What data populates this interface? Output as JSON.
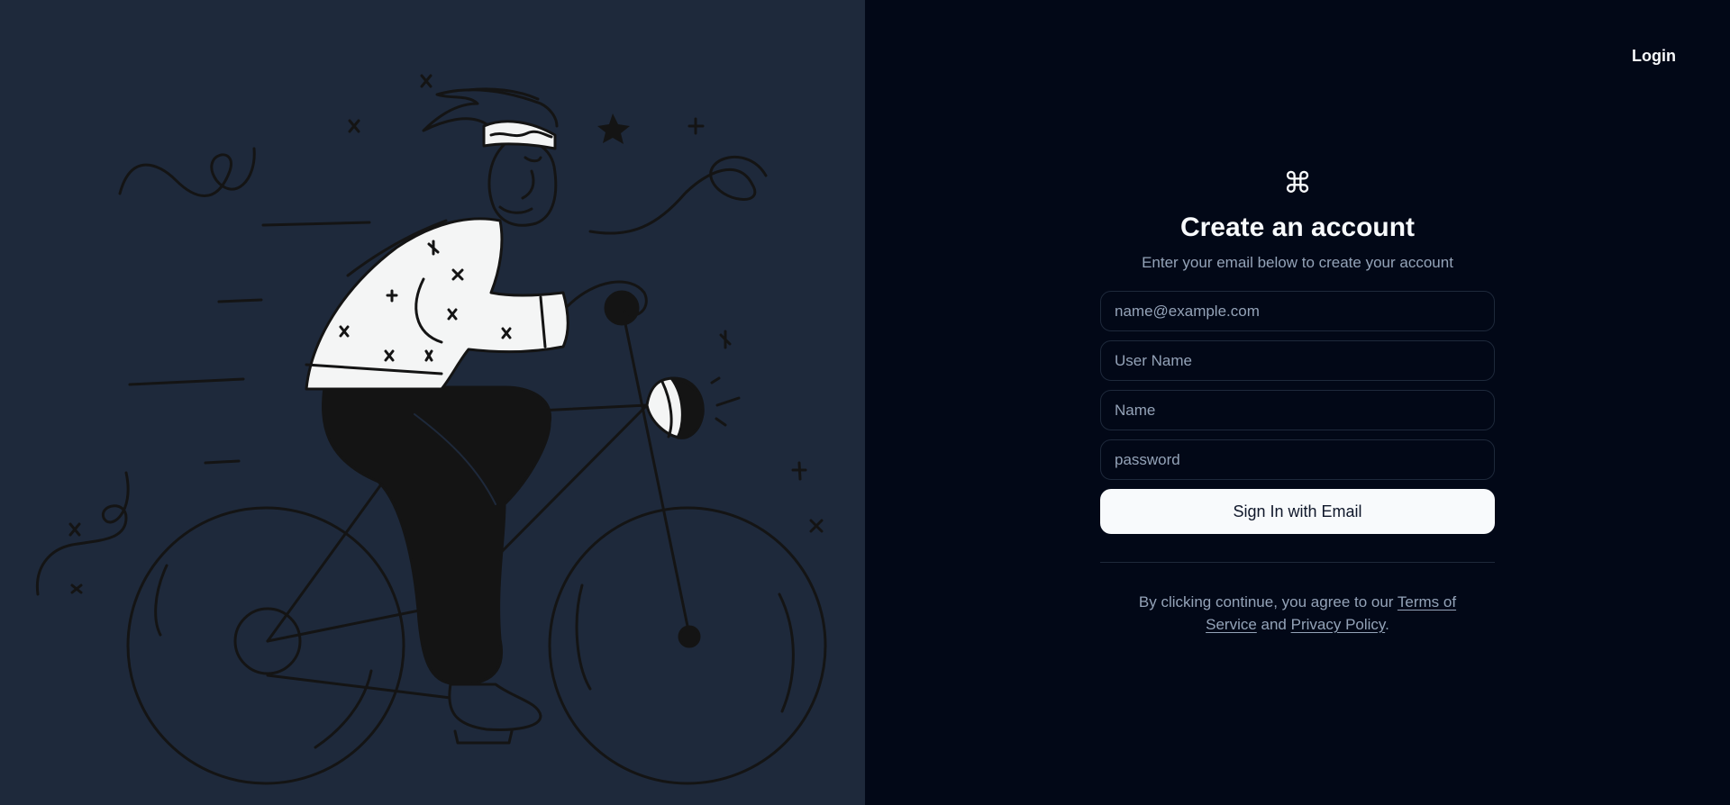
{
  "header": {
    "login_label": "Login"
  },
  "illustration": {
    "icon": "cyclist-illustration"
  },
  "form": {
    "logo_icon": "⌘",
    "title": "Create an account",
    "subtitle": "Enter your email below to create your account",
    "email_placeholder": "name@example.com",
    "username_placeholder": "User Name",
    "name_placeholder": "Name",
    "password_placeholder": "password",
    "submit_label": "Sign In with Email"
  },
  "terms": {
    "prefix": "By clicking continue, you agree to our ",
    "terms_link": "Terms of Service",
    "connector": " and ",
    "privacy_link": "Privacy Policy",
    "suffix": "."
  },
  "colors": {
    "left_panel_bg": "#1e293b",
    "right_panel_bg": "#020817",
    "text_primary": "#f8fafc",
    "text_muted": "#94a3b8",
    "border": "#1e293b"
  }
}
